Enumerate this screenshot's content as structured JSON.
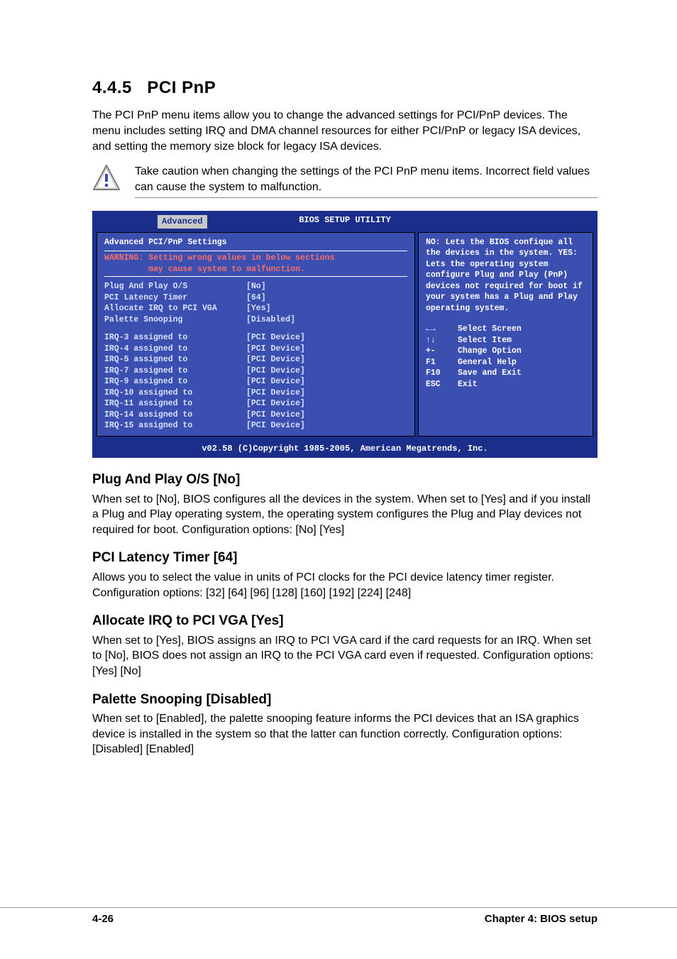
{
  "head": {
    "number": "4.4.5",
    "title": "PCI PnP",
    "intro": "The PCI PnP menu items allow you to change the advanced settings for PCI/PnP devices. The menu includes setting IRQ and DMA channel resources for either PCI/PnP or legacy ISA devices, and setting the memory size block for legacy ISA devices."
  },
  "caution": "Take caution when changing the settings of the PCI PnP menu items. Incorrect field values can cause the system to malfunction.",
  "bios": {
    "title": "BIOS SETUP UTILITY",
    "tab": "Advanced",
    "panel_heading": "Advanced PCI/PnP Settings",
    "warning_l1": "WARNING: Setting wrong values in below sections",
    "warning_l2": "         may cause system to malfunction.",
    "rows_a": [
      {
        "label": "Plug And Play O/S",
        "value": "[No]"
      },
      {
        "label": "PCI Latency Timer",
        "value": "[64]"
      },
      {
        "label": "Allocate IRQ to PCI VGA",
        "value": "[Yes]"
      },
      {
        "label": "Palette Snooping",
        "value": "[Disabled]"
      }
    ],
    "rows_b": [
      {
        "label": "IRQ-3 assigned to",
        "value": "[PCI Device]"
      },
      {
        "label": "IRQ-4 assigned to",
        "value": "[PCI Device]"
      },
      {
        "label": "IRQ-5 assigned to",
        "value": "[PCI Device]"
      },
      {
        "label": "IRQ-7 assigned to",
        "value": "[PCI Device]"
      },
      {
        "label": "IRQ-9 assigned to",
        "value": "[PCI Device]"
      },
      {
        "label": "IRQ-10 assigned to",
        "value": "[PCI Device]"
      },
      {
        "label": "IRQ-11 assigned to",
        "value": "[PCI Device]"
      },
      {
        "label": "IRQ-14 assigned to",
        "value": "[PCI Device]"
      },
      {
        "label": "IRQ-15 assigned to",
        "value": "[PCI Device]"
      }
    ],
    "help_text": "NO: Lets the BIOS confique all the devices in the system. YES: Lets the operating system configure Plug and Play (PnP) devices not required for boot if your system has a Plug and Play operating system.",
    "nav": [
      {
        "key": "←→",
        "label": "Select Screen"
      },
      {
        "key": "↑↓",
        "label": "Select Item"
      },
      {
        "key": "+-",
        "label": "Change Option"
      },
      {
        "key": "F1",
        "label": "General Help"
      },
      {
        "key": "F10",
        "label": "Save and Exit"
      },
      {
        "key": "ESC",
        "label": "Exit"
      }
    ],
    "footer": "v02.58 (C)Copyright 1985-2005, American Megatrends, Inc."
  },
  "sections": [
    {
      "title": "Plug And Play O/S [No]",
      "body": "When set to [No], BIOS configures all the devices in the system. When set to [Yes] and if you install a Plug and Play operating system, the operating system configures the Plug and Play devices not required for boot. Configuration options: [No] [Yes]"
    },
    {
      "title": "PCI Latency Timer [64]",
      "body": "Allows you to select the value in units of PCI clocks for the PCI device latency timer register. Configuration options: [32] [64] [96] [128] [160] [192] [224] [248]"
    },
    {
      "title": "Allocate IRQ to PCI VGA [Yes]",
      "body": "When set to [Yes], BIOS assigns an IRQ to PCI VGA card if the card requests for an IRQ. When set to [No], BIOS does not assign an IRQ to the PCI VGA card even if requested. Configuration options: [Yes] [No]"
    },
    {
      "title": "Palette Snooping [Disabled]",
      "body": "When set to [Enabled], the palette snooping feature informs the PCI devices that an ISA graphics device is installed in the system so that the latter can function correctly. Configuration options: [Disabled] [Enabled]"
    }
  ],
  "footer": {
    "left": "4-26",
    "right": "Chapter 4: BIOS setup"
  }
}
